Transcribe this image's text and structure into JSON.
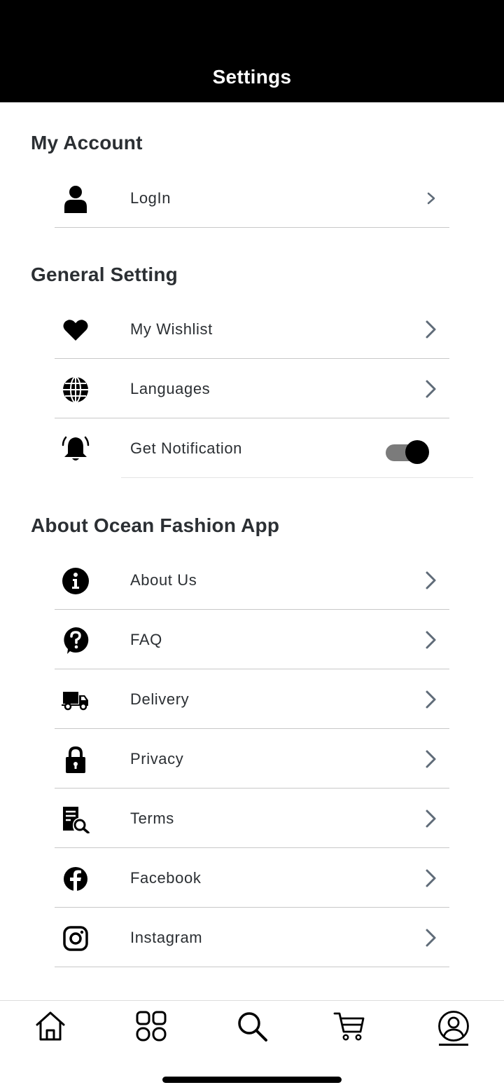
{
  "header": {
    "title": "Settings"
  },
  "sections": {
    "account": {
      "title": "My Account"
    },
    "general": {
      "title": "General Setting"
    },
    "about": {
      "title": "About Ocean Fashion App"
    }
  },
  "rows": {
    "login": {
      "label": "LogIn",
      "icon": "user-icon"
    },
    "wishlist": {
      "label": "My Wishlist",
      "icon": "heart-icon"
    },
    "languages": {
      "label": "Languages",
      "icon": "globe-icon"
    },
    "notification": {
      "label": "Get Notification",
      "icon": "bell-icon",
      "enabled": true
    },
    "about_us": {
      "label": "About Us",
      "icon": "info-icon"
    },
    "faq": {
      "label": "FAQ",
      "icon": "question-icon"
    },
    "delivery": {
      "label": "Delivery",
      "icon": "truck-icon"
    },
    "privacy": {
      "label": "Privacy",
      "icon": "lock-icon"
    },
    "terms": {
      "label": "Terms",
      "icon": "document-search-icon"
    },
    "facebook": {
      "label": "Facebook",
      "icon": "facebook-icon"
    },
    "instagram": {
      "label": "Instagram",
      "icon": "instagram-icon"
    }
  },
  "tabbar": {
    "tabs": [
      "home-icon",
      "grid-icon",
      "search-icon",
      "cart-icon",
      "profile-icon"
    ],
    "active": "profile"
  },
  "colors": {
    "header_bg": "#000000",
    "text": "#2b2f33",
    "divider": "#c8c8c8",
    "chevron": "#5f6b78",
    "toggle_track": "#7b7b7b"
  }
}
